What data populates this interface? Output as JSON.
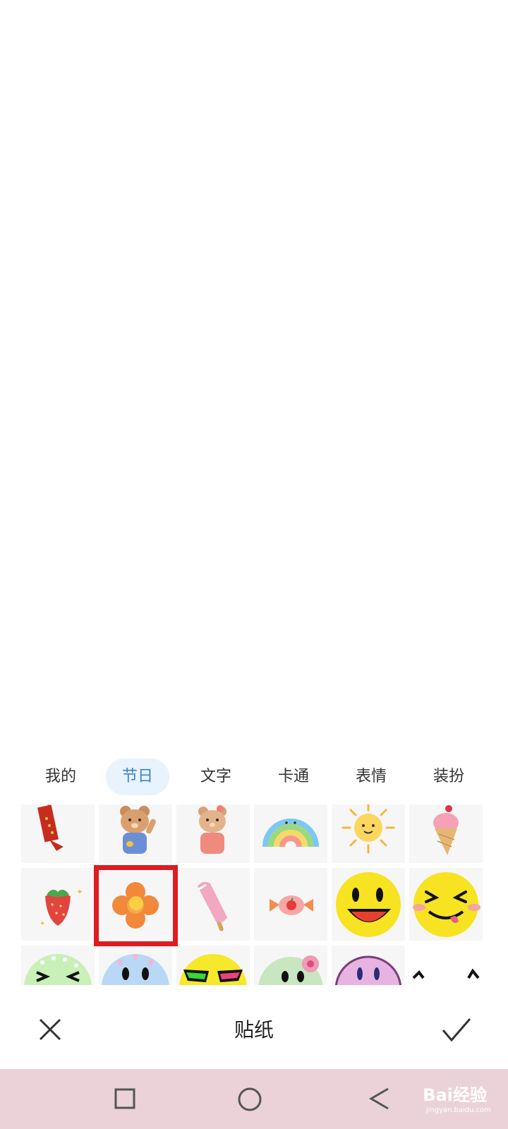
{
  "tabs": [
    {
      "label": "我的",
      "active": false
    },
    {
      "label": "节日",
      "active": true
    },
    {
      "label": "文字",
      "active": false
    },
    {
      "label": "卡通",
      "active": false
    },
    {
      "label": "表情",
      "active": false
    },
    {
      "label": "装扮",
      "active": false
    }
  ],
  "stickers": [
    "red-banner-sticker",
    "bear-waving-sticker",
    "bear-pink-sticker",
    "rainbow-sticker",
    "sun-sticker",
    "ice-cream-sticker",
    "strawberry-sticker",
    "orange-flower-sticker",
    "popsicle-sticker",
    "candy-sticker",
    "smiley-face-sticker",
    "laughing-face-sticker",
    "green-dotted-face-sticker",
    "blue-checkered-face-sticker",
    "sunglasses-face-sticker",
    "flower-frog-sticker",
    "purple-face-sticker",
    "doodle-face-sticker"
  ],
  "bottom_bar": {
    "title": "贴纸"
  },
  "nav_bar": {
    "icons": [
      "square-icon",
      "circle-icon",
      "triangle-back-icon"
    ]
  },
  "watermark": {
    "brand": "Bai经验",
    "url": "jingyan.baidu.com"
  },
  "colors": {
    "accent": "#3c84c8",
    "active_tab_bg": "#e8f3fd",
    "highlight": "#e01b22",
    "nav_bg": "#ebd2d8"
  }
}
